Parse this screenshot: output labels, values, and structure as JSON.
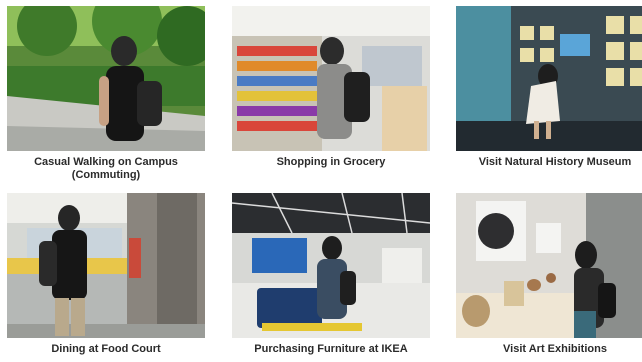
{
  "scenes": [
    {
      "caption": "Casual Walking on Campus (Commuting)"
    },
    {
      "caption": "Shopping in Grocery"
    },
    {
      "caption": "Visit Natural History Museum"
    },
    {
      "caption": "Dining at Food Court"
    },
    {
      "caption": "Purchasing Furniture at IKEA"
    },
    {
      "caption": "Visit Art Exhibitions"
    }
  ]
}
